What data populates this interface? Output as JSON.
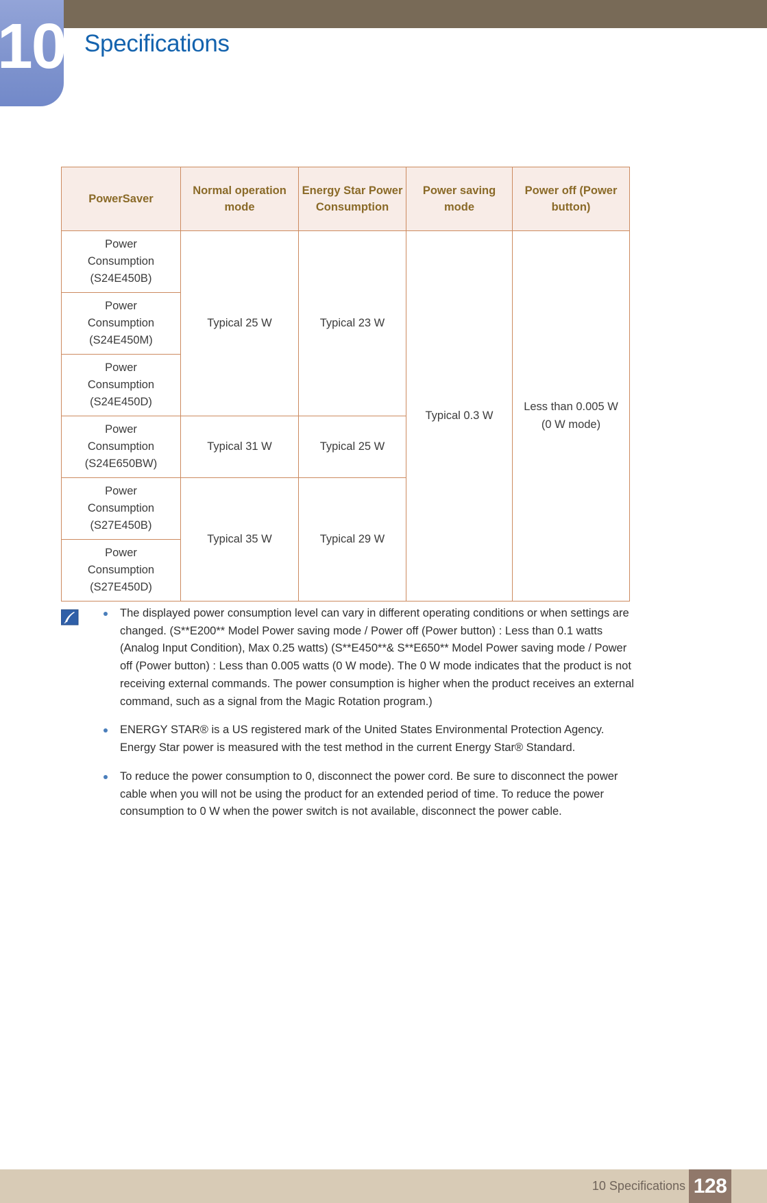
{
  "header": {
    "chapter_number": "10",
    "title": "Specifications",
    "bar_color": "#786a57",
    "badge_color": "#8296cf",
    "title_color": "#1463ae"
  },
  "table": {
    "columns": [
      "PowerSaver",
      "Normal operation mode",
      "Energy Star Power Consumption",
      "Power saving mode",
      "Power off (Power button)"
    ],
    "columns_lines": [
      [
        "PowerSaver"
      ],
      [
        "Normal",
        "operation mode"
      ],
      [
        "Energy Star",
        "Power",
        "Consumption"
      ],
      [
        "Power saving",
        "mode"
      ],
      [
        "Power off",
        "(Power button)"
      ]
    ],
    "header_bg": "#f8ece7",
    "header_text_color": "#8a6a28",
    "border_color": "#cc8a5f",
    "rows": [
      {
        "label_lines": [
          "Power",
          "Consumption",
          "(S24E450B)"
        ],
        "model": "S24E450B"
      },
      {
        "label_lines": [
          "Power",
          "Consumption",
          "(S24E450M)"
        ],
        "model": "S24E450M"
      },
      {
        "label_lines": [
          "Power",
          "Consumption",
          "(S24E450D)"
        ],
        "model": "S24E450D"
      },
      {
        "label_lines": [
          "Power",
          "Consumption",
          "(S24E650BW)"
        ],
        "model": "S24E650BW"
      },
      {
        "label_lines": [
          "Power",
          "Consumption",
          "(S27E450B)"
        ],
        "model": "S27E450B"
      },
      {
        "label_lines": [
          "Power",
          "Consumption",
          "(S27E450D)"
        ],
        "model": "S27E450D"
      }
    ],
    "values": {
      "normal_group1": "Typical 25 W",
      "energystar_group1": "Typical 23 W",
      "normal_group2": "Typical 31 W",
      "energystar_group2": "Typical 25 W",
      "normal_group3": "Typical 35 W",
      "energystar_group3": "Typical 29 W",
      "power_saving": "Typical 0.3 W",
      "power_off_line1": "Less than 0.005 W",
      "power_off_line2": "(0 W mode)"
    }
  },
  "notes": {
    "icon": "note-pen-icon",
    "items": [
      "The displayed power consumption level can vary in different operating conditions or when settings are changed. (S**E200** Model Power saving mode / Power off (Power button) : Less than 0.1 watts (Analog Input Condition), Max 0.25 watts) (S**E450**& S**E650** Model Power saving mode / Power off (Power button) : Less than 0.005 watts (0 W mode). The 0 W mode indicates that the product is not receiving external commands. The power consumption is higher when the product receives an external command, such as a signal from the Magic Rotation program.)",
      "ENERGY STAR® is a US registered mark of the United States Environmental Protection Agency. Energy Star power is measured with the test method in the current Energy Star® Standard.",
      "To reduce the power consumption to 0, disconnect the power cord. Be sure to disconnect the power cable when you will not be using the product for an extended period of time. To reduce the power consumption to 0 W when the power switch is not available, disconnect the power cable."
    ]
  },
  "footer": {
    "text": "10 Specifications",
    "page_number": "128",
    "bar_color": "#d8cbb6",
    "page_box_color": "#90786a"
  }
}
